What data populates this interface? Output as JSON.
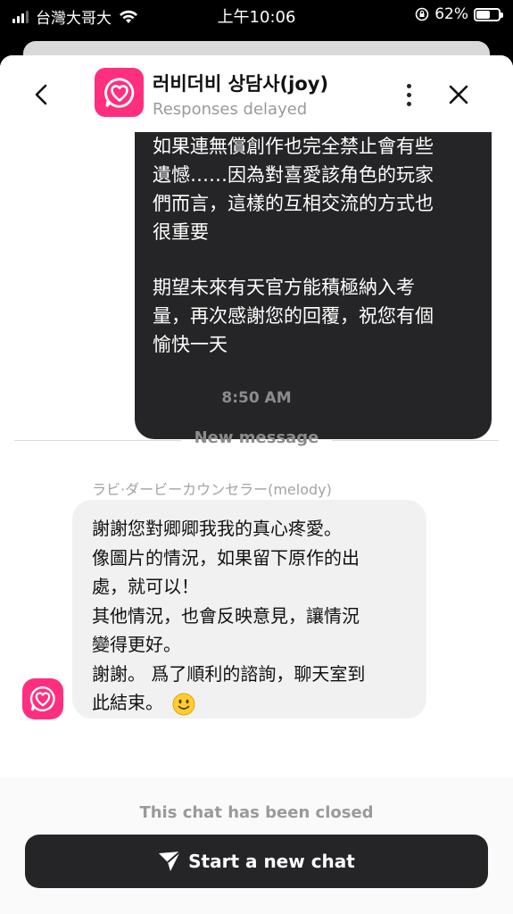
{
  "status_bar": {
    "carrier": "台灣大哥大",
    "time": "上午10:06",
    "battery": "62%",
    "battery_level": 0.62
  },
  "header": {
    "title": "러비더비 상담사(joy)",
    "subtitle": "Responses delayed"
  },
  "messages": {
    "outgoing": {
      "lines_1": [
        "如果連無償創作也完全禁止會有些",
        "遺憾……因為對喜愛該角色的玩家",
        "們而言，這樣的互相交流的方式也",
        "很重要"
      ],
      "lines_2": [
        "期望未來有天官方能積極納入考",
        "量，再次感謝您的回覆，祝您有個",
        "愉快一天"
      ]
    },
    "timestamp": "8:50 AM",
    "new_message_label": "New message",
    "incoming": {
      "sender": "ラビ·ダービーカウンセラー(melody)",
      "lines": [
        "謝謝您對卿卿我我的真心疼愛。",
        "像圖片的情況，如果留下原作的出",
        "處，就可以！",
        "其他情況，也會反映意見，讓情況",
        "變得更好。",
        "謝謝。 爲了順利的諮詢，聊天室到",
        "此結束。"
      ]
    }
  },
  "footer": {
    "closed_text": "This chat has been closed",
    "new_chat_label": "Start a new chat"
  },
  "colors": {
    "brand_pink": "#ff2e7e",
    "dark_bubble": "#252527",
    "light_bubble": "#f1f1f2"
  }
}
